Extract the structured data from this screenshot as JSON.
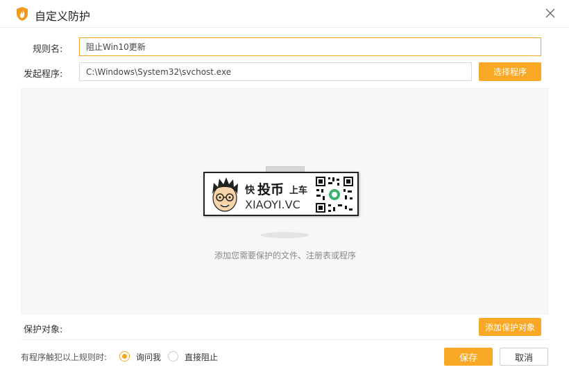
{
  "window": {
    "title": "自定义防护",
    "logo_icon": "shield-flame-icon",
    "close_icon": "close-icon"
  },
  "form": {
    "rule_name_label": "规则名:",
    "rule_name_value": "阻止Win10更新",
    "program_label": "发起程序:",
    "program_value": "C:\\Windows\\System32\\svchost.exe",
    "choose_program_button": "选择程序"
  },
  "protect_area": {
    "empty_hint": "添加您需要保护的文件、注册表或程序",
    "promo": {
      "kuai": "快",
      "toubi": "投币",
      "shangche": "上车",
      "domain": "XIAOYI.VC"
    },
    "label": "保护对象:",
    "add_button": "添加保护对象"
  },
  "footer": {
    "trigger_label": "有程序触犯以上规则时:",
    "options": [
      {
        "label": "询问我",
        "selected": true
      },
      {
        "label": "直接阻止",
        "selected": false
      }
    ],
    "save_button": "保存",
    "cancel_button": "取消"
  },
  "colors": {
    "accent": "#f9a825",
    "accent_border": "#f5a623",
    "text": "#333333",
    "hint": "#888888"
  }
}
